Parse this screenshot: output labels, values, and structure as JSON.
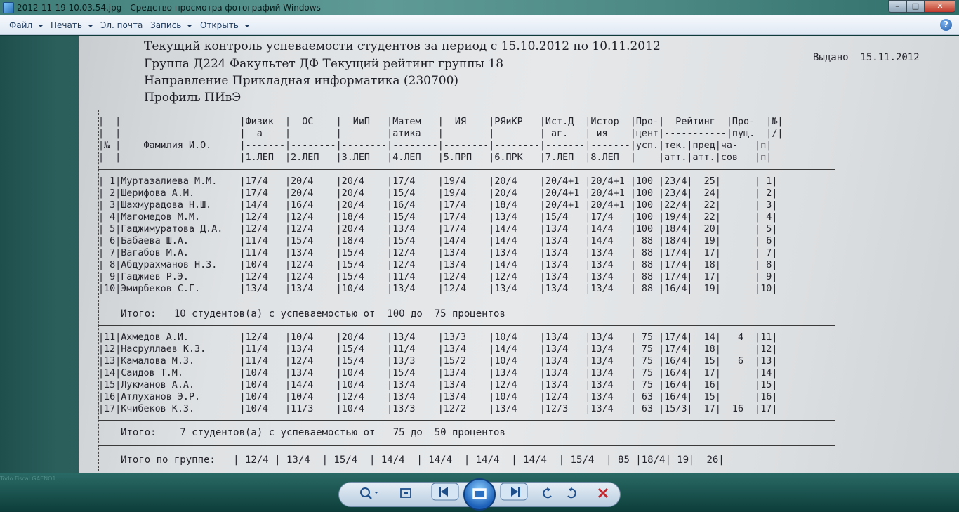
{
  "window": {
    "title": "2012-11-19 10.03.54.jpg - Средство просмотра фотографий Windows",
    "controls": {
      "minimize": "–",
      "maximize": "□",
      "close": "✕"
    }
  },
  "menu": {
    "items": [
      {
        "label": "Файл",
        "icon": "caret-down"
      },
      {
        "label": "Печать",
        "icon": "caret-down"
      },
      {
        "label": "Эл. почта",
        "icon": null
      },
      {
        "label": "Запись",
        "icon": "caret-down"
      },
      {
        "label": "Открыть",
        "icon": "caret-down"
      }
    ],
    "help": "?"
  },
  "document": {
    "heading_lines": [
      "Текущий контроль успеваемости студентов за период  с 15.10.2012 по 10.11.2012",
      "Группа  Д224    Факультет ДФ        Текущий рейтинг  группы   18",
      "Направление Прикладная информатика (230700)",
      "Профиль ПИвЭ"
    ],
    "issued": "Выдано  15.11.2012",
    "table_header_lines": [
      "|  |                     |Физик  |  ОС    |  ИиП   |Матем   |  ИЯ    |РЯиКР   |Ист.Д  |Истор  |Про-|  Рейтинг  |Про-  |№|",
      "|  |                     |  а    |        |        |атика   |        |        | аг.   | ия    |цент|-----------|пущ.  |/|",
      "|№ |    Фамилия И.О.     |-------|--------|--------|--------|--------|--------|-------|-------|усп.|тек.|пред|ча-   |п|",
      "|  |                     |1.ЛЕП  |2.ЛЕП   |3.ЛЕП   |4.ЛЕП   |5.ПРП   |6.ПРК   |7.ЛЕП  |8.ЛЕП  |    |атт.|атт.|сов   |п|"
    ],
    "group1_rows": [
      "| 1|Муртазалиева М.М.    |17/4   |20/4    |20/4    |17/4    |19/4    |20/4    |20/4+1 |20/4+1 |100 |23/4|  25|      | 1|",
      "| 2|Шерифова А.М.        |17/4   |20/4    |20/4    |15/4    |19/4    |20/4    |20/4+1 |20/4+1 |100 |23/4|  24|      | 2|",
      "| 3|Шахмурадова Н.Ш.     |14/4   |16/4    |20/4    |16/4    |17/4    |18/4    |20/4+1 |20/4+1 |100 |22/4|  22|      | 3|",
      "| 4|Магомедов М.М.       |12/4   |12/4    |18/4    |15/4    |17/4    |13/4    |15/4   |17/4   |100 |19/4|  22|      | 4|",
      "| 5|Гаджимуратова Д.А.   |12/4   |12/4    |20/4    |13/4    |17/4    |14/4    |13/4   |14/4   |100 |18/4|  20|      | 5|",
      "| 6|Бабаева Ш.А.         |11/4   |15/4    |18/4    |15/4    |14/4    |14/4    |13/4   |14/4   | 88 |18/4|  19|      | 6|",
      "| 7|Вагабов М.А.         |11/4   |13/4    |15/4    |12/4    |13/4    |13/4    |13/4   |13/4   | 88 |17/4|  17|      | 7|",
      "| 8|Абдурахманов Н.З.    |10/4   |12/4    |15/4    |12/4    |13/4    |14/4    |13/4   |13/4   | 88 |17/4|  18|      | 8|",
      "| 9|Гаджиев Р.Э.         |12/4   |12/4    |15/4    |11/4    |12/4    |12/4    |13/4   |13/4   | 88 |17/4|  17|      | 9|",
      "|10|Эмирбеков С.Г.       |13/4   |13/4    |10/4    |13/4    |12/4    |13/4    |13/4   |13/4   | 88 |16/4|  19|      |10|"
    ],
    "group1_total": "Итого:   10 студентов(а) с успеваемостью от  100 до  75 процентов",
    "group2_rows": [
      "|11|Ахмедов А.И.         |12/4   |10/4    |20/4    |13/4    |13/3    |10/4    |13/4   |13/4   | 75 |17/4|  14|   4  |11|",
      "|12|Насруллаев К.З.      |11/4   |13/4    |15/4    |11/4    |13/4    |14/4    |13/4   |13/4   | 75 |17/4|  18|      |12|",
      "|13|Камалова М.З.        |11/4   |12/4    |15/4    |13/3    |15/2    |10/4    |13/4   |13/4   | 75 |16/4|  15|   6  |13|",
      "|14|Саидов Т.М.          |10/4   |13/4    |10/4    |15/4    |13/4    |13/4    |13/4   |13/4   | 75 |16/4|  17|      |14|",
      "|15|Лукманов А.А.        |10/4   |14/4    |10/4    |13/4    |13/4    |12/4    |13/4   |13/4   | 75 |16/4|  16|      |15|",
      "|16|Атлуханов Э.Р.       |10/4   |10/4    |12/4    |13/4    |13/4    |10/4    |12/4   |13/4   | 63 |16/4|  15|      |16|",
      "|17|Кчибеков К.З.        |10/4   |11/3    |10/4    |13/3    |12/2    |13/4    |12/3   |13/4   | 63 |15/3|  17|  16  |17|"
    ],
    "group2_total": "Итого:    7 студентов(а) с успеваемостью от   75 до  50 процентов",
    "group_total": "Итого по группе:   | 12/4 | 13/4  | 15/4  | 14/4  | 14/4  | 14/4  | 14/4  | 15/4  | 85 |18/4| 19|  26|"
  },
  "toolbar": {
    "buttons": [
      {
        "name": "zoom",
        "icon": "magnifier-icon"
      },
      {
        "name": "fit",
        "icon": "fit-window-icon"
      },
      {
        "name": "previous",
        "icon": "previous-icon"
      },
      {
        "name": "slideshow",
        "icon": "slideshow-icon"
      },
      {
        "name": "next",
        "icon": "next-icon"
      },
      {
        "name": "rotate-left",
        "icon": "rotate-ccw-icon"
      },
      {
        "name": "rotate-right",
        "icon": "rotate-cw-icon"
      },
      {
        "name": "delete",
        "icon": "delete-icon"
      }
    ],
    "ghost_text": "Todo Fiscal GAENO1 ..."
  }
}
